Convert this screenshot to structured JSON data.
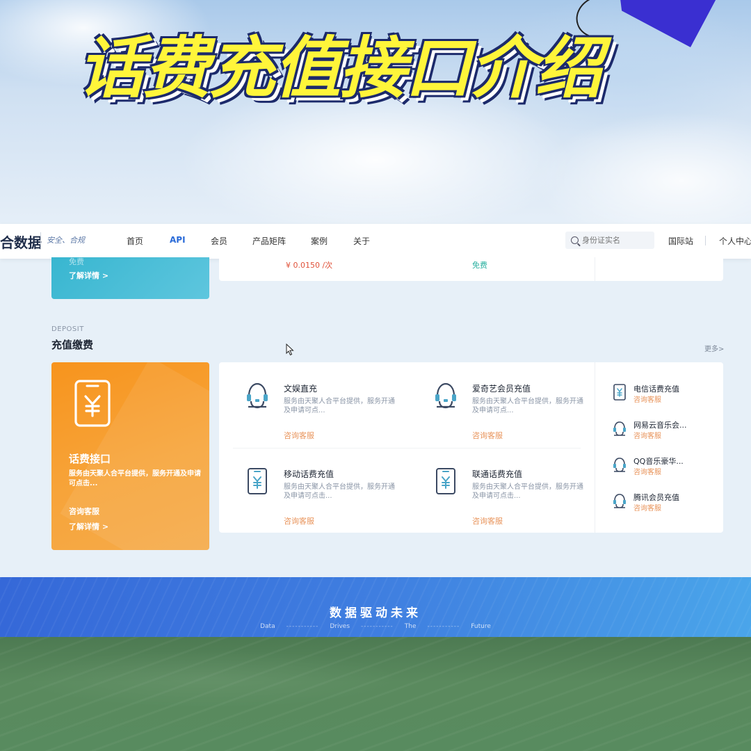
{
  "hero": {
    "title": "话费充值接口介绍"
  },
  "navbar": {
    "brand": "合数据",
    "slogan": "安全、合规",
    "items": [
      "首页",
      "API",
      "会员",
      "产品矩阵",
      "案例",
      "关于"
    ],
    "active_index": 1,
    "search_placeholder": "身份证实名",
    "international": "国际站",
    "user_center": "个人中心"
  },
  "top_row": {
    "left_card_faint": "免费",
    "left_card_more": "了解详情 >",
    "price": "¥ 0.0150 /次",
    "free": "免费"
  },
  "section": {
    "en_label": "DEPOSIT",
    "title": "充值缴费",
    "more": "更多>"
  },
  "feature": {
    "title": "话费接口",
    "desc": "服务由天聚人合平台提供，服务开通及申请可点击...",
    "consult": "咨询客服",
    "more": "了解详情 >",
    "icon": "phone-yuan-icon"
  },
  "products": [
    {
      "title": "文娱直充",
      "desc": "服务由天聚人合平台提供，服务开通及申请可点...",
      "consult": "咨询客服",
      "icon": "support-agent-icon"
    },
    {
      "title": "爱奇艺会员充值",
      "desc": "服务由天聚人合平台提供，服务开通及申请可点...",
      "consult": "咨询客服",
      "icon": "support-agent-icon"
    },
    {
      "title": "移动话费充值",
      "desc": "服务由天聚人合平台提供，服务开通及申请可点击...",
      "consult": "咨询客服",
      "icon": "phone-yuan-icon"
    },
    {
      "title": "联通话费充值",
      "desc": "服务由天聚人合平台提供，服务开通及申请可点击...",
      "consult": "咨询客服",
      "icon": "phone-yuan-icon"
    }
  ],
  "side_items": [
    {
      "title": "电信话费充值",
      "consult": "咨询客服",
      "icon": "phone-yuan-icon"
    },
    {
      "title": "网易云音乐会...",
      "consult": "咨询客服",
      "icon": "support-agent-icon"
    },
    {
      "title": "QQ音乐豪华...",
      "consult": "咨询客服",
      "icon": "support-agent-icon"
    },
    {
      "title": "腾讯会员充值",
      "consult": "咨询客服",
      "icon": "support-agent-icon"
    }
  ],
  "banner": {
    "title": "数据驱动未来",
    "sub": [
      "Data",
      "Drives",
      "The",
      "Future"
    ],
    "dash": "-----------"
  },
  "colors": {
    "accent": "#2a6bd8",
    "feature_orange": "#f7941d",
    "consult_orange": "#e8935a",
    "hero_yellow": "#fff53a",
    "banner_blue": "#3f7ee0"
  }
}
